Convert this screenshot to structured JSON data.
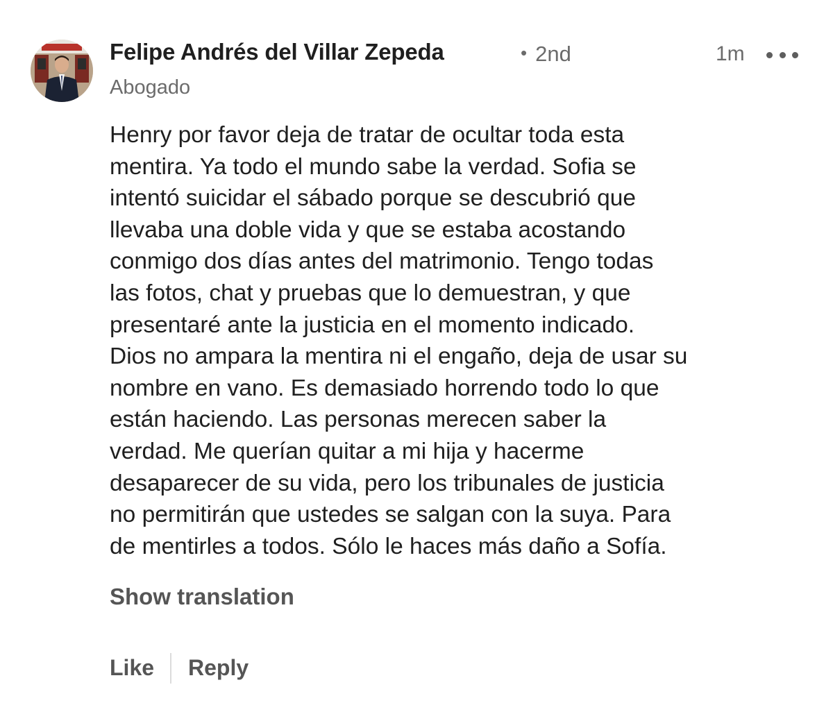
{
  "author": {
    "name": "Felipe Andrés del Villar Zepeda",
    "degree": "2nd",
    "headline": "Abogado"
  },
  "comment": {
    "timestamp": "1m",
    "lines": [
      "Henry por favor deja de tratar de ocultar toda esta",
      "mentira. Ya todo el mundo sabe la verdad. Sofia se",
      "intentó suicidar el sábado porque se descubrió que",
      "llevaba una doble vida y que se estaba acostando",
      "conmigo dos días antes del matrimonio. Tengo todas",
      "las fotos, chat y pruebas que lo demuestran, y que",
      "presentaré ante la justicia en el momento indicado.",
      "Dios no ampara la mentira ni el engaño, deja de usar su",
      "nombre en vano. Es demasiado horrendo todo lo que",
      "están haciendo. Las personas merecen saber la",
      "verdad. Me querían quitar a mi hija y hacerme",
      "desaparecer de su vida, pero los tribunales de justicia",
      "no permitirán que ustedes se salgan con la suya. Para",
      "de mentirles a todos. Sólo le haces más daño a Sofía."
    ],
    "show_translation": "Show translation"
  },
  "actions": {
    "like": "Like",
    "reply": "Reply"
  },
  "icons": {
    "avatar": "profile-photo",
    "more": "more-options-icon"
  },
  "colors": {
    "text_primary": "#1f1f1f",
    "text_secondary": "#6b6b6b",
    "action_text": "#555555"
  }
}
